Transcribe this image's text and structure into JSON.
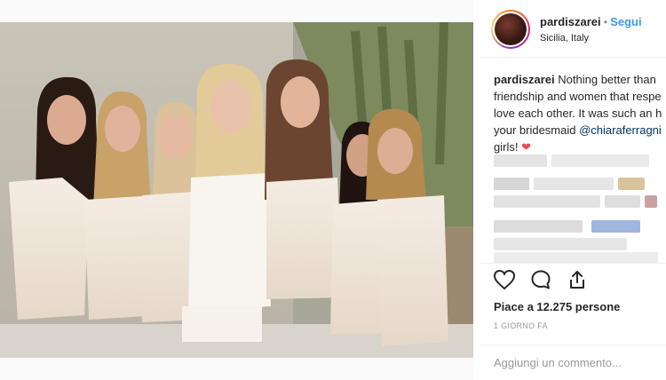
{
  "post": {
    "username": "pardiszarei",
    "separator": "•",
    "follow_label": "Segui",
    "location": "Sicilia, Italy"
  },
  "caption": {
    "username": "pardiszarei",
    "line1": "Nothing better than",
    "line2": "friendship and women that respe",
    "line3": "love each other. It was such an h",
    "line4_prefix": "your bridesmaid ",
    "mention": "@chiaraferragni",
    "line5": "girls!",
    "emoji": "❤"
  },
  "icons": {
    "like": "heart-outline-icon",
    "comment": "speech-bubble-icon",
    "share": "share-icon"
  },
  "likes_text": "Piace a 12.275 persone",
  "time_text": "1 GIORNO FA",
  "comment": {
    "placeholder": "Aggiungi un commento..."
  },
  "colors": {
    "follow": "#3897f0",
    "mention": "#003569",
    "heart": "#ed4956",
    "muted": "#999999"
  }
}
